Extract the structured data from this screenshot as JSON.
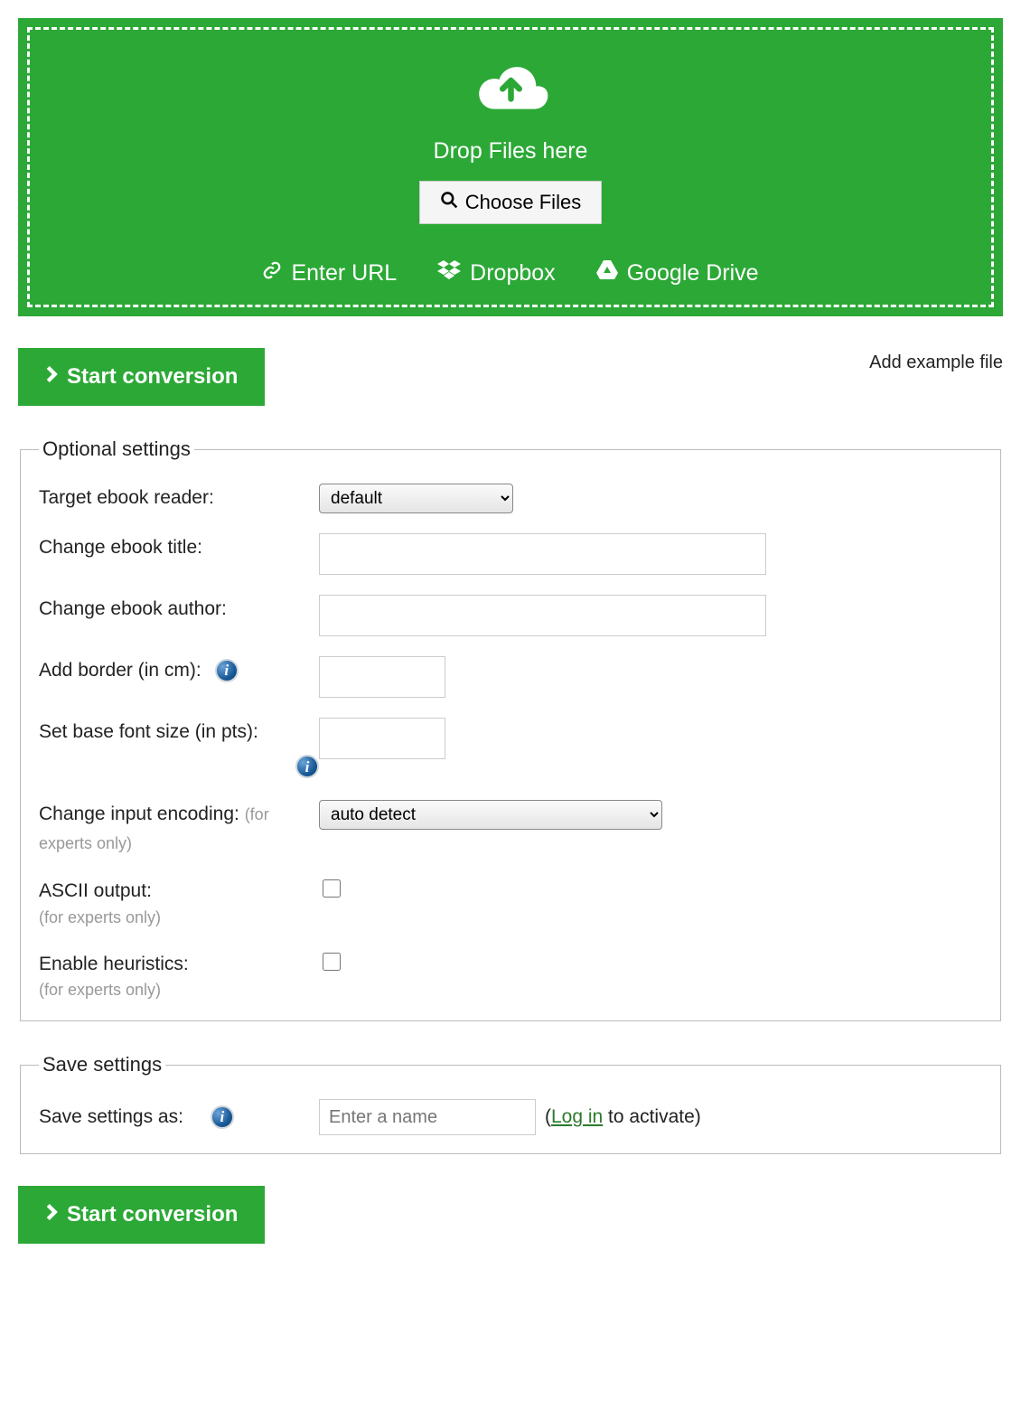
{
  "dropzone": {
    "drop_text": "Drop Files here",
    "choose_label": "Choose Files",
    "sources": {
      "url": "Enter URL",
      "dropbox": "Dropbox",
      "gdrive": "Google Drive"
    }
  },
  "actions": {
    "start_label": "Start conversion",
    "example_label": "Add example file"
  },
  "optional": {
    "legend": "Optional settings",
    "target_reader_label": "Target ebook reader:",
    "target_reader_value": "default",
    "title_label": "Change ebook title:",
    "title_value": "",
    "author_label": "Change ebook author:",
    "author_value": "",
    "border_label": "Add border (in cm):",
    "border_value": "",
    "font_label": "Set base font size (in pts):",
    "font_value": "",
    "encoding_label": "Change input encoding: ",
    "encoding_hint": "(for experts only)",
    "encoding_value": "auto detect",
    "ascii_label": "ASCII output:",
    "ascii_hint": "(for experts only)",
    "heur_label": "Enable heuristics:",
    "heur_hint": "(for experts only)"
  },
  "save": {
    "legend": "Save settings",
    "label": "Save settings as:",
    "placeholder": "Enter a name",
    "msg_open": "(",
    "login_text": "Log in",
    "msg_close": " to activate)"
  }
}
